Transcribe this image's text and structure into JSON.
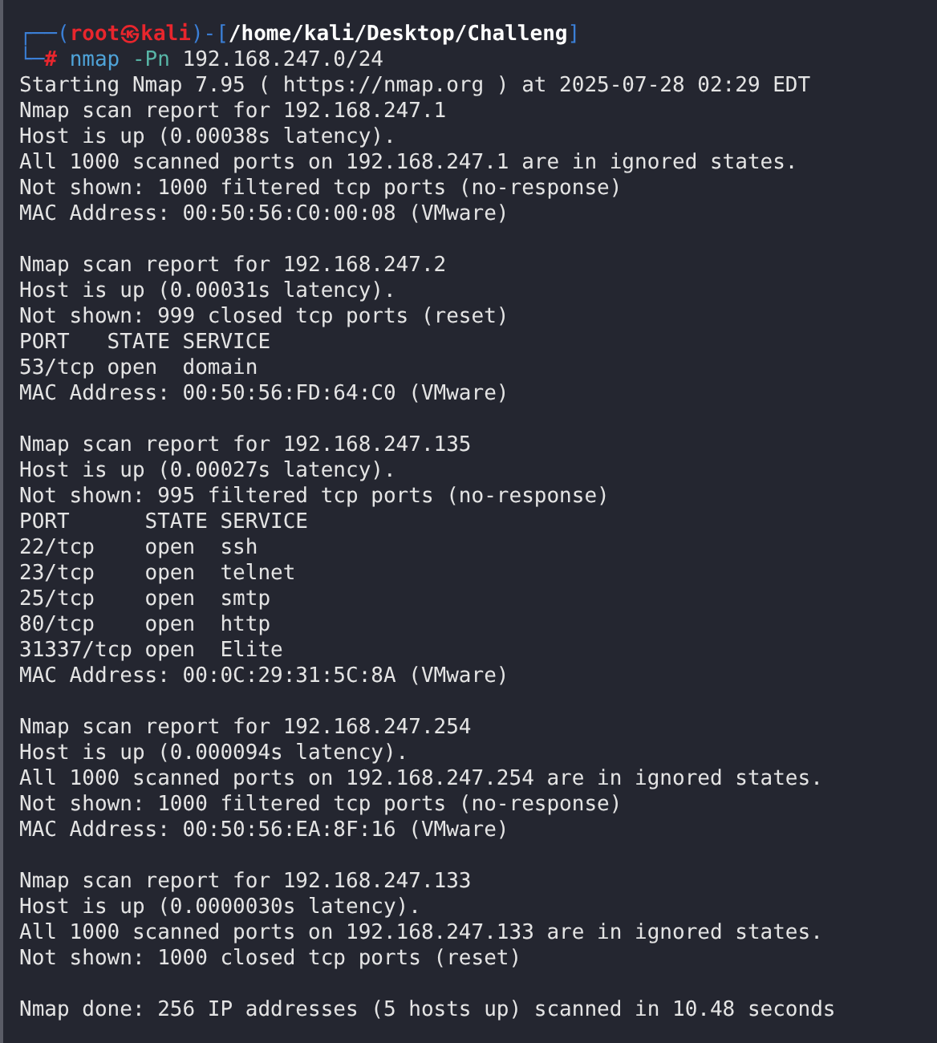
{
  "prompt": {
    "top_open": "┌──(",
    "user_host": "root㉿kali",
    "separator": ")-[",
    "path": "/home/kali/Desktop/Challeng",
    "top_close": "]",
    "bottom_open": "└─",
    "symbol": "#",
    "command": "nmap",
    "option": "-Pn",
    "argument": "192.168.247.0/24"
  },
  "output": [
    [
      "Starting Nmap 7.95 ( https://nmap.org ) at 2025-07-28 02:29 EDT",
      "Nmap scan report for 192.168.247.1",
      "Host is up (0.00038s latency).",
      "All 1000 scanned ports on 192.168.247.1 are in ignored states.",
      "Not shown: 1000 filtered tcp ports (no-response)",
      "MAC Address: 00:50:56:C0:00:08 (VMware)"
    ],
    [
      "Nmap scan report for 192.168.247.2",
      "Host is up (0.00031s latency).",
      "Not shown: 999 closed tcp ports (reset)",
      "PORT   STATE SERVICE",
      "53/tcp open  domain",
      "MAC Address: 00:50:56:FD:64:C0 (VMware)"
    ],
    [
      "Nmap scan report for 192.168.247.135",
      "Host is up (0.00027s latency).",
      "Not shown: 995 filtered tcp ports (no-response)",
      "PORT      STATE SERVICE",
      "22/tcp    open  ssh",
      "23/tcp    open  telnet",
      "25/tcp    open  smtp",
      "80/tcp    open  http",
      "31337/tcp open  Elite",
      "MAC Address: 00:0C:29:31:5C:8A (VMware)"
    ],
    [
      "Nmap scan report for 192.168.247.254",
      "Host is up (0.000094s latency).",
      "All 1000 scanned ports on 192.168.247.254 are in ignored states.",
      "Not shown: 1000 filtered tcp ports (no-response)",
      "MAC Address: 00:50:56:EA:8F:16 (VMware)"
    ],
    [
      "Nmap scan report for 192.168.247.133",
      "Host is up (0.0000030s latency).",
      "All 1000 scanned ports on 192.168.247.133 are in ignored states.",
      "Not shown: 1000 closed tcp ports (reset)"
    ],
    [
      "Nmap done: 256 IP addresses (5 hosts up) scanned in 10.48 seconds"
    ]
  ]
}
